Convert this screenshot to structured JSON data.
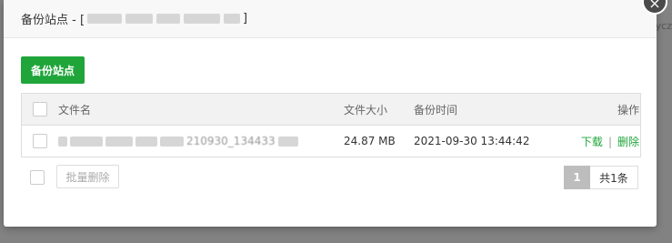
{
  "background": {
    "partial_text": "ycz"
  },
  "modal": {
    "title_prefix": "备份站点 - [",
    "title_suffix": "]",
    "close_icon": "×"
  },
  "toolbar": {
    "backup_button": "备份站点"
  },
  "table": {
    "headers": {
      "filename": "文件名",
      "size": "文件大小",
      "time": "备份时间",
      "ops": "操作"
    },
    "rows": [
      {
        "filename_visible": "210930_134433",
        "size": "24.87 MB",
        "time": "2021-09-30 13:44:42",
        "download": "下载",
        "separator": "|",
        "delete": "删除"
      }
    ]
  },
  "footer": {
    "batch_delete": "批量删除",
    "current_page": "1",
    "total": "共1条"
  },
  "colors": {
    "accent": "#20a53a"
  }
}
